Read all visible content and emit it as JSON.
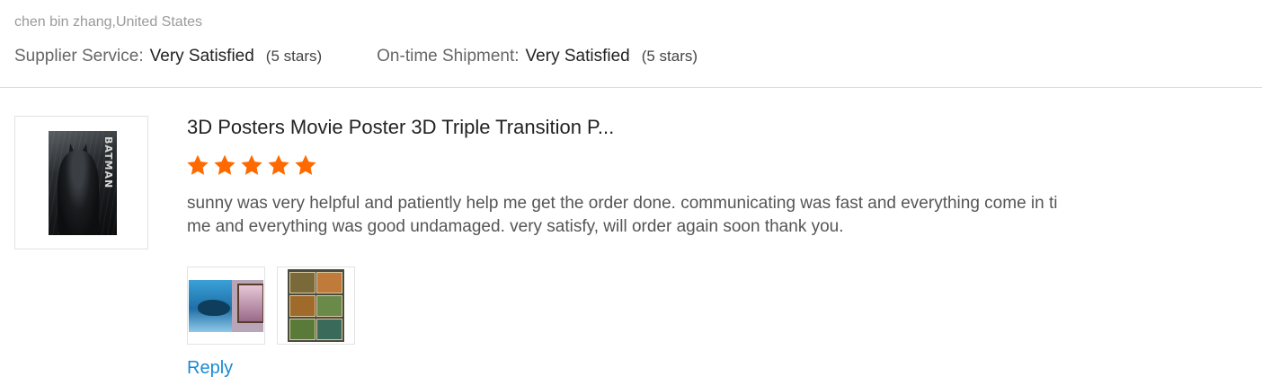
{
  "reviewer": {
    "name_location": "chen bin zhang,United States"
  },
  "ratings": [
    {
      "label": "Supplier Service:",
      "value": "Very Satisfied",
      "stars": "(5 stars)"
    },
    {
      "label": "On-time Shipment:",
      "value": "Very Satisfied",
      "stars": "(5 stars)"
    }
  ],
  "product": {
    "title": "3D Posters Movie Poster 3D Triple Transition P...",
    "thumbnail_text": "BATMAN",
    "rating": 5,
    "rating_max": 5
  },
  "review": {
    "text": "sunny was very helpful and patiently help me get the order done. communicating was fast and everything come in time and everything was good undamaged. very satisfy, will order again soon thank you."
  },
  "reply": {
    "label": "Reply"
  },
  "colors": {
    "star": "#ff6a00",
    "link": "#1a8ad6",
    "divider": "#dcdcdc"
  }
}
